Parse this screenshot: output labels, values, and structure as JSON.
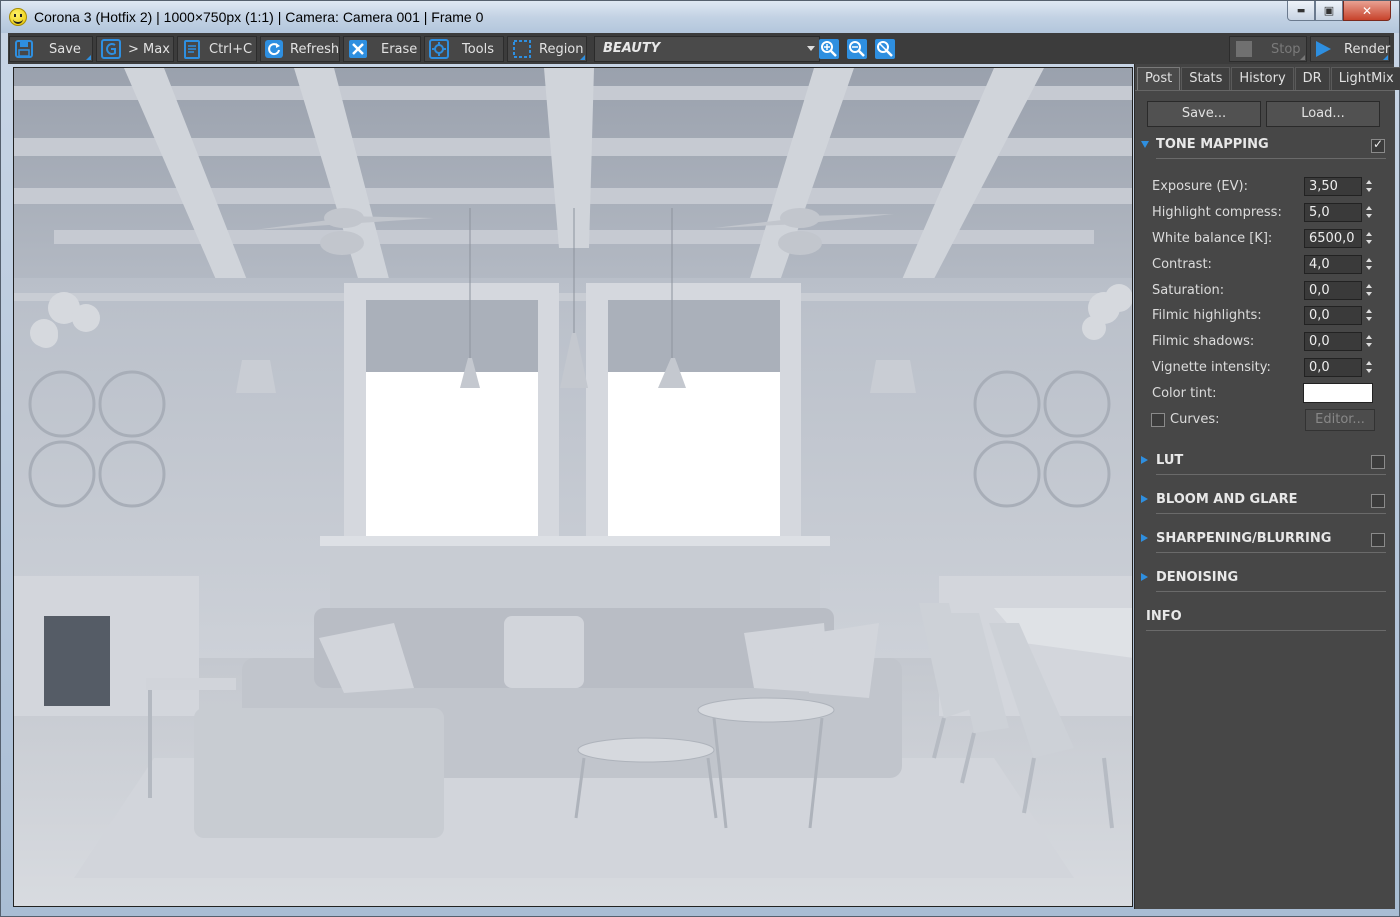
{
  "window": {
    "title": "Corona 3 (Hotfix 2) | 1000×750px (1:1) | Camera: Camera 001 | Frame 0",
    "min_glyph": "▬",
    "max_glyph": "▣",
    "close_glyph": "✕"
  },
  "toolbar": {
    "save_label": "Save",
    "max_label": "> Max",
    "copy_label": "Ctrl+C",
    "refresh_label": "Refresh",
    "erase_label": "Erase",
    "tools_label": "Tools",
    "region_label": "Region",
    "render_pass": "BEAUTY",
    "stop_label": "Stop",
    "render_label": "Render"
  },
  "panel": {
    "tabs": [
      {
        "label": "Post",
        "active": true
      },
      {
        "label": "Stats"
      },
      {
        "label": "History"
      },
      {
        "label": "DR"
      },
      {
        "label": "LightMix"
      }
    ],
    "save_label": "Save...",
    "load_label": "Load...",
    "tone_mapping": {
      "title": "TONE MAPPING",
      "enabled": true,
      "rows": [
        {
          "label": "Exposure (EV):",
          "value": "3,50"
        },
        {
          "label": "Highlight compress:",
          "value": "5,0"
        },
        {
          "label": "White balance [K]:",
          "value": "6500,0"
        },
        {
          "label": "Contrast:",
          "value": "4,0"
        },
        {
          "label": "Saturation:",
          "value": "0,0"
        },
        {
          "label": "Filmic highlights:",
          "value": "0,0"
        },
        {
          "label": "Filmic shadows:",
          "value": "0,0"
        },
        {
          "label": "Vignette intensity:",
          "value": "0,0"
        }
      ],
      "color_tint_label": "Color tint:",
      "color_tint_value": "#ffffff",
      "curves_label": "Curves:",
      "curves_enabled": false,
      "editor_label": "Editor..."
    },
    "sections": [
      {
        "title": "LUT",
        "enabled": false
      },
      {
        "title": "BLOOM AND GLARE",
        "enabled": false
      },
      {
        "title": "SHARPENING/BLURRING",
        "enabled": false
      },
      {
        "title": "DENOISING"
      }
    ],
    "info_label": "INFO"
  },
  "colors": {
    "accent": "#2e8fe0",
    "panel_bg": "#474747",
    "toolbar_bg": "#3c3c3c"
  }
}
